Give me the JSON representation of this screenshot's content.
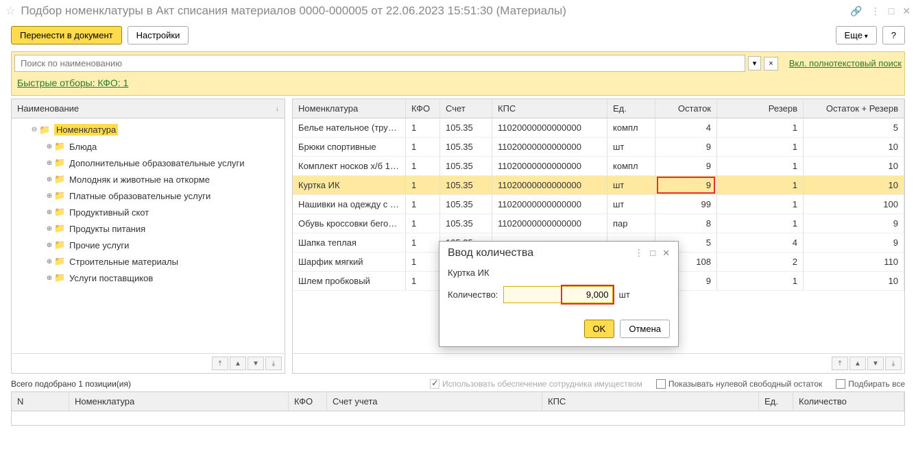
{
  "window": {
    "title": "Подбор номенклатуры в Акт списания материалов 0000-000005 от 22.06.2023 15:51:30 (Материалы)"
  },
  "toolbar": {
    "transfer": "Перенести в документ",
    "settings": "Настройки",
    "more": "Еще",
    "help": "?"
  },
  "filter": {
    "search_placeholder": "Поиск по наименованию",
    "fulltext_link": "Вкл. полнотекстовый поиск",
    "quick_filters": "Быстрые отборы: КФО: 1"
  },
  "tree": {
    "header": "Наименование",
    "root": "Номенклатура",
    "items": [
      "Блюда",
      "Дополнительные образовательные услуги",
      "Молодняк и животные на откорме",
      "Платные образовательные услуги",
      "Продуктивный скот",
      "Продукты питания",
      "Прочие услуги",
      "Строительные материалы",
      "Услуги поставщиков"
    ]
  },
  "table": {
    "headers": {
      "nom": "Номенклатура",
      "kfo": "КФО",
      "acct": "Счет",
      "kps": "КПС",
      "unit": "Ед.",
      "ost": "Остаток",
      "res": "Резерв",
      "total": "Остаток + Резерв"
    },
    "rows": [
      {
        "nom": "Белье нательное (тру…",
        "kfo": "1",
        "acct": "105.35",
        "kps": "11020000000000000",
        "unit": "компл",
        "ost": "4",
        "res": "1",
        "total": "5"
      },
      {
        "nom": "Брюки спортивные",
        "kfo": "1",
        "acct": "105.35",
        "kps": "11020000000000000",
        "unit": "шт",
        "ost": "9",
        "res": "1",
        "total": "10"
      },
      {
        "nom": "Комплект носков х/б 1…",
        "kfo": "1",
        "acct": "105.35",
        "kps": "11020000000000000",
        "unit": "компл",
        "ost": "9",
        "res": "1",
        "total": "10"
      },
      {
        "nom": "Куртка ИК",
        "kfo": "1",
        "acct": "105.35",
        "kps": "11020000000000000",
        "unit": "шт",
        "ost": "9",
        "res": "1",
        "total": "10"
      },
      {
        "nom": "Нашивки на одежду с …",
        "kfo": "1",
        "acct": "105.35",
        "kps": "11020000000000000",
        "unit": "шт",
        "ost": "99",
        "res": "1",
        "total": "100"
      },
      {
        "nom": "Обувь кроссовки бего…",
        "kfo": "1",
        "acct": "105.35",
        "kps": "11020000000000000",
        "unit": "пар",
        "ost": "8",
        "res": "1",
        "total": "9"
      },
      {
        "nom": "Шапка теплая",
        "kfo": "1",
        "acct": "105.35",
        "kps": "",
        "unit": "",
        "ost": "5",
        "res": "4",
        "total": "9"
      },
      {
        "nom": "Шарфик мягкий",
        "kfo": "1",
        "acct": "",
        "kps": "",
        "unit": "",
        "ost": "108",
        "res": "2",
        "total": "110"
      },
      {
        "nom": "Шлем пробковый",
        "kfo": "1",
        "acct": "",
        "kps": "",
        "unit": "",
        "ost": "9",
        "res": "1",
        "total": "10"
      }
    ],
    "highlighted_index": 3,
    "boxed_cell": {
      "row": 3,
      "col": "ost"
    }
  },
  "status": {
    "text": "Всего подобрано 1 позиции(ия)",
    "use_provision": "Использовать обеспечение сотрудника имуществом",
    "show_zero": "Показывать нулевой свободный остаток",
    "select_all": "Подбирать все"
  },
  "bottom_table": {
    "headers": {
      "n": "N",
      "nom": "Номенклатура",
      "kfo": "КФО",
      "acct": "Счет учета",
      "kps": "КПС",
      "unit": "Ед.",
      "qty": "Количество"
    }
  },
  "dialog": {
    "title": "Ввод количества",
    "item": "Куртка ИК",
    "qty_label": "Количество:",
    "qty_value": "9,000",
    "unit": "шт",
    "ok": "OK",
    "cancel": "Отмена"
  }
}
